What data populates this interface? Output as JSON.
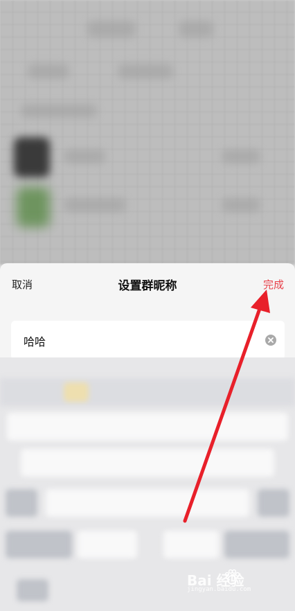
{
  "sheet": {
    "cancel_label": "取消",
    "title": "设置群昵称",
    "done_label": "完成"
  },
  "nickname_field": {
    "value": "哈哈"
  },
  "watermark": {
    "brand": "Bai 经验",
    "url": "jingyan.baidu.com"
  },
  "colors": {
    "accent": "#e8414a",
    "annotation_arrow": "#e8202a"
  }
}
